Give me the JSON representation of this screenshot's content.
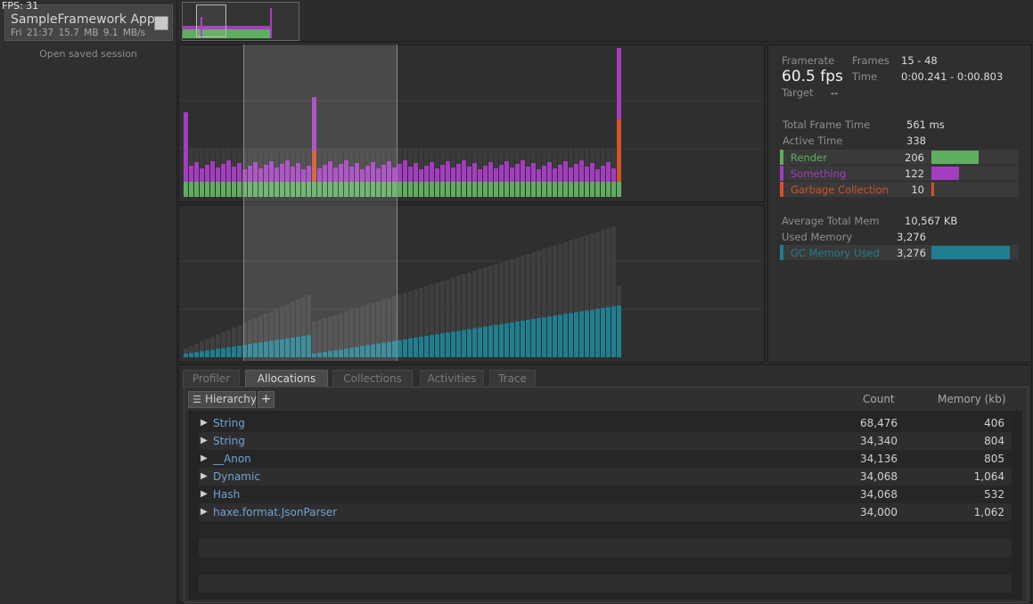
{
  "fps_counter": "FPS: 31",
  "session": {
    "app_name": "SampleFramework App",
    "time": "Fri 21:37",
    "mem": "15.7 MB",
    "rate": "9.1 MB/s",
    "open_saved": "Open saved session"
  },
  "stats": {
    "framerate_label": "Framerate",
    "framerate_value": "60.5 fps",
    "target_label": "Target",
    "target_value": "--",
    "frames_label": "Frames",
    "frames_value": "15 - 48",
    "time_label": "Time",
    "time_value": "0:00.241 - 0:00.803",
    "total_frame_time_label": "Total Frame Time",
    "total_frame_time_value": "561 ms",
    "active_time_label": "Active Time",
    "active_time_value": "338",
    "breakdown": [
      {
        "label": "Render",
        "value": "206",
        "color": "#5fae5f",
        "fraction": 0.54
      },
      {
        "label": "Something",
        "value": "122",
        "color": "#a43dc0",
        "fraction": 0.32
      },
      {
        "label": "Garbage Collection",
        "value": "10",
        "color": "#d0532a",
        "fraction": 0.03
      }
    ],
    "avg_mem_label": "Average Total Mem",
    "avg_mem_value": "10,567 KB",
    "used_mem_label": "Used Memory",
    "used_mem_value": "3,276",
    "gc_mem_label": "GC Memory Used",
    "gc_mem_value": "3,276",
    "gc_mem_color": "#1f7f91",
    "gc_mem_fraction": 0.9
  },
  "tabs": [
    {
      "label": "Profiler",
      "active": false
    },
    {
      "label": "Allocations",
      "active": true
    },
    {
      "label": "Collections",
      "active": false
    },
    {
      "label": "Activities",
      "active": false
    },
    {
      "label": "Trace",
      "active": false
    }
  ],
  "table": {
    "hierarchy_label": "Hierarchy",
    "plus": "+",
    "col_count": "Count",
    "col_memory": "Memory (kb)",
    "rows": [
      {
        "name": "String",
        "count": "68,476",
        "memory": "406"
      },
      {
        "name": "String",
        "count": "34,340",
        "memory": "804"
      },
      {
        "name": "__Anon",
        "count": "34,136",
        "memory": "805"
      },
      {
        "name": "Dynamic",
        "count": "34,068",
        "memory": "1,064"
      },
      {
        "name": "Hash",
        "count": "34,068",
        "memory": "532"
      },
      {
        "name": "haxe.format.JsonParser",
        "count": "34,000",
        "memory": "1,062"
      }
    ]
  }
}
